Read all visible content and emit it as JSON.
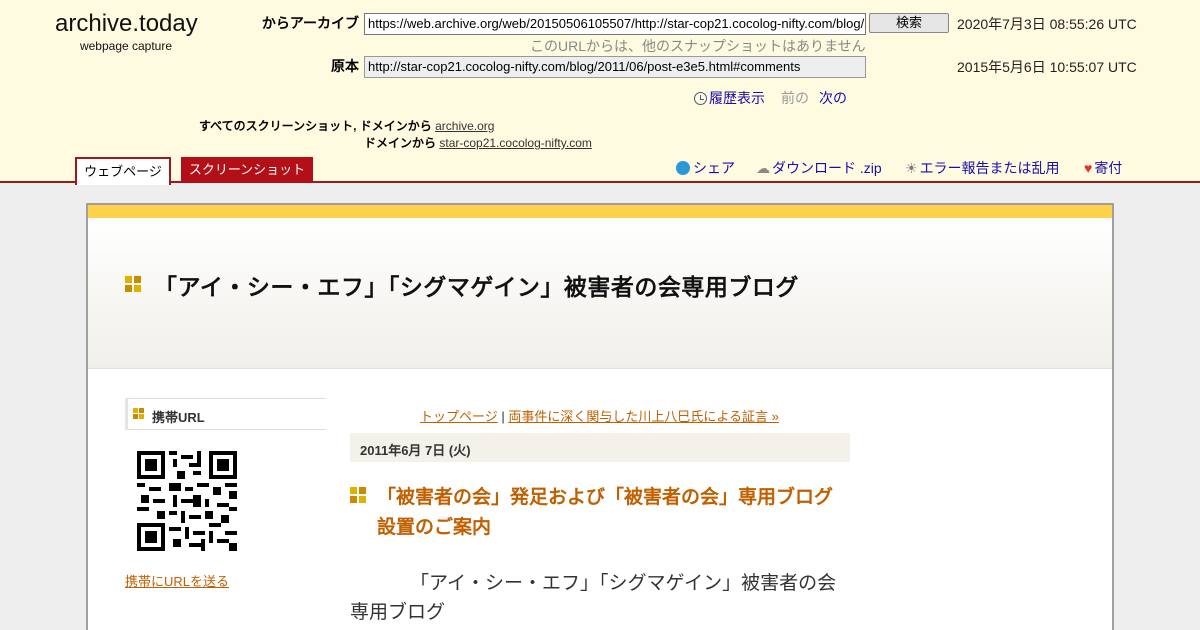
{
  "archive": {
    "logo_title": "archive.today",
    "logo_subtitle": "webpage capture",
    "archived_label": "からアーカイブ",
    "archived_url": "https://web.archive.org/web/20150506105507/http://star-cop21.cocolog-nifty.com/blog/2",
    "search_button": "検索",
    "archived_time": "2020年7月3日 08:55:26 UTC",
    "no_other_snapshots": "このURLからは、他のスナップショットはありません",
    "original_label": "原本",
    "original_url": "http://star-cop21.cocolog-nifty.com/blog/2011/06/post-e3e5.html#comments",
    "original_time": "2015年5月6日 10:55:07 UTC",
    "history_link": "履歴表示",
    "prev_label": "前の",
    "next_label": "次の",
    "all_screenshots_label": "すべてのスクリーンショット, ドメインから",
    "domain_label": "ドメインから",
    "domain1": "archive.org",
    "domain2": "star-cop21.cocolog-nifty.com",
    "tab_webpage": "ウェブページ",
    "tab_screenshot": "スクリーンショット",
    "share": "シェア",
    "download": "ダウンロード .zip",
    "report": "エラー報告または乱用",
    "donate": "寄付"
  },
  "blog": {
    "title": "「アイ・シー・エフ」「シグマゲイン」被害者の会専用ブログ",
    "sidebar_title": "携帯URL",
    "sidebar_link": "携帯にURLを送る",
    "crumb_home": "トップページ",
    "crumb_sep": " | ",
    "crumb_next": "両事件に深く関与した川上八巳氏による証言 »",
    "date": "2011年6月 7日 (火)",
    "post_title": "「被害者の会」発足および「被害者の会」専用ブログ設置のご案内",
    "post_body": "「アイ・シー・エフ」「シグマゲイン」被害者の会専用ブログ"
  },
  "colors": {
    "archive_bg": "#fffbe0",
    "archive_red": "#9a1b1f",
    "blog_accent": "#ffd24a",
    "link_orange": "#c06000"
  }
}
